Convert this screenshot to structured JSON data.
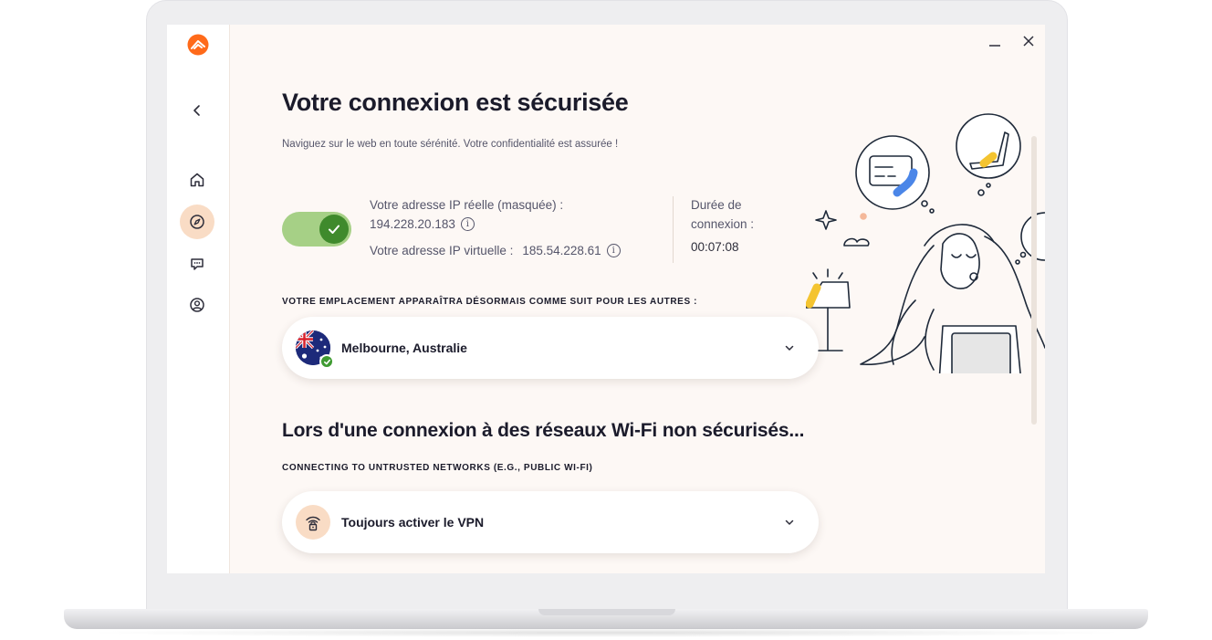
{
  "window": {
    "minimize_label": "—",
    "close_label": "✕"
  },
  "sidebar": {
    "items": [
      {
        "icon": "home-icon"
      },
      {
        "icon": "compass-icon",
        "active": true
      },
      {
        "icon": "chat-icon"
      },
      {
        "icon": "account-icon"
      }
    ]
  },
  "header": {
    "title_prefix": "Votre ",
    "title_highlight": "connexion est sécurisée",
    "subtitle": "Naviguez sur le web en toute sérénité. Votre confidentialité est assurée !"
  },
  "connection": {
    "vpn_toggle_on": true,
    "real_ip_label": "Votre adresse IP réelle (masquée) :",
    "real_ip_value": "194.228.20.183",
    "virtual_ip_label": "Votre adresse IP virtuelle :",
    "virtual_ip_value": "185.54.228.61",
    "duration_label_line1": "Durée de",
    "duration_label_line2": "connexion :",
    "duration_value": "00:07:08"
  },
  "location": {
    "caption": "VOTRE EMPLACEMENT APPARAÎTRA DÉSORMAIS COMME SUIT POUR LES AUTRES :",
    "selected": "Melbourne, Australie"
  },
  "wifi": {
    "heading": "Lors d'une connexion à des réseaux Wi-Fi non sécurisés...",
    "caption": "CONNECTING TO UNTRUSTED NETWORKS (E.G., PUBLIC WI-FI)",
    "selected": "Toujours activer le VPN"
  },
  "colors": {
    "accent": "#ff6a1a",
    "highlight": "#b6e57a",
    "toggle_on": "#3f8a2c",
    "background": "#fdf8f5"
  }
}
